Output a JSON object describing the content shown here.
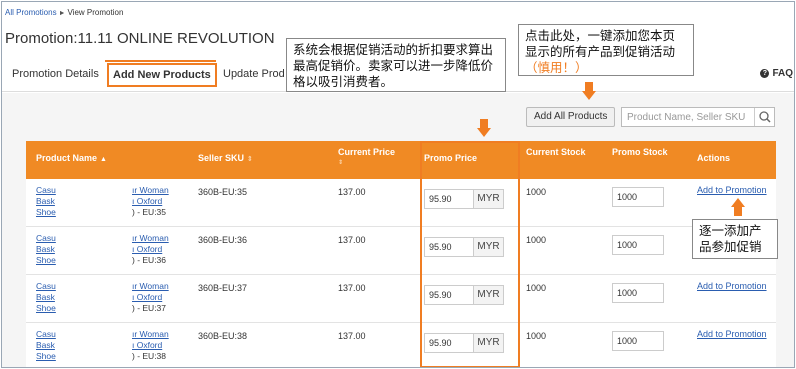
{
  "breadcrumb": {
    "root": "All Promotions",
    "separator": "►",
    "current": "View Promotion"
  },
  "page": {
    "title": "Promotion:11.11 ONLINE REVOLUTION"
  },
  "tabs": [
    {
      "label": "Promotion Details"
    },
    {
      "label": "Add New Products"
    },
    {
      "label": "Update Prod"
    }
  ],
  "faq": {
    "label": "FAQ"
  },
  "callouts": {
    "discount_note": "系统会根据促销活动的折扣要求算出最高促销价。卖家可以进一步降低价格以吸引消费者。",
    "add_all_note": "点击此处，一键添加您本页显示的所有产品到促销活动",
    "add_all_warning": "（慎用！）",
    "add_one_note": "逐一添加产品参加促销"
  },
  "toolbar": {
    "add_all_label": "Add All Products",
    "search_placeholder": "Product Name, Seller SKU"
  },
  "table": {
    "headers": {
      "product_name": "Product Name",
      "seller_sku": "Seller SKU",
      "current_price": "Current Price",
      "promo_price": "Promo Price",
      "current_stock": "Current Stock",
      "promo_stock": "Promo Stock",
      "actions": "Actions"
    },
    "rows": [
      {
        "name_left": [
          "Casu",
          "Bask",
          "Shoe"
        ],
        "name_right": [
          "ır Woman",
          "ı Oxford",
          ") - EU:35"
        ],
        "sku": "360B-EU:35",
        "current_price": "137.00",
        "promo_price": "95.90",
        "currency": "MYR",
        "current_stock": "1000",
        "promo_stock": "1000",
        "action": "Add to Promotion"
      },
      {
        "name_left": [
          "Casu",
          "Bask",
          "Shoe"
        ],
        "name_right": [
          "ır Woman",
          "ı Oxford",
          ") - EU:36"
        ],
        "sku": "360B-EU:36",
        "current_price": "137.00",
        "promo_price": "95.90",
        "currency": "MYR",
        "current_stock": "1000",
        "promo_stock": "1000",
        "action": "Add to Promotion"
      },
      {
        "name_left": [
          "Casu",
          "Bask",
          "Shoe"
        ],
        "name_right": [
          "ır Woman",
          "ı Oxford",
          ") - EU:37"
        ],
        "sku": "360B-EU:37",
        "current_price": "137.00",
        "promo_price": "95.90",
        "currency": "MYR",
        "current_stock": "1000",
        "promo_stock": "1000",
        "action": "Add to Promotion"
      },
      {
        "name_left": [
          "Casu",
          "Bask",
          "Shoe"
        ],
        "name_right": [
          "ır Woman",
          "ı Oxford",
          ") - EU:38"
        ],
        "sku": "360B-EU:38",
        "current_price": "137.00",
        "promo_price": "95.90",
        "currency": "MYR",
        "current_stock": "1000",
        "promo_stock": "1000",
        "action": "Add to Promotion"
      }
    ]
  },
  "colors": {
    "accent": "#f07d22",
    "header_bg": "#f08a24",
    "link": "#2a5db0"
  }
}
